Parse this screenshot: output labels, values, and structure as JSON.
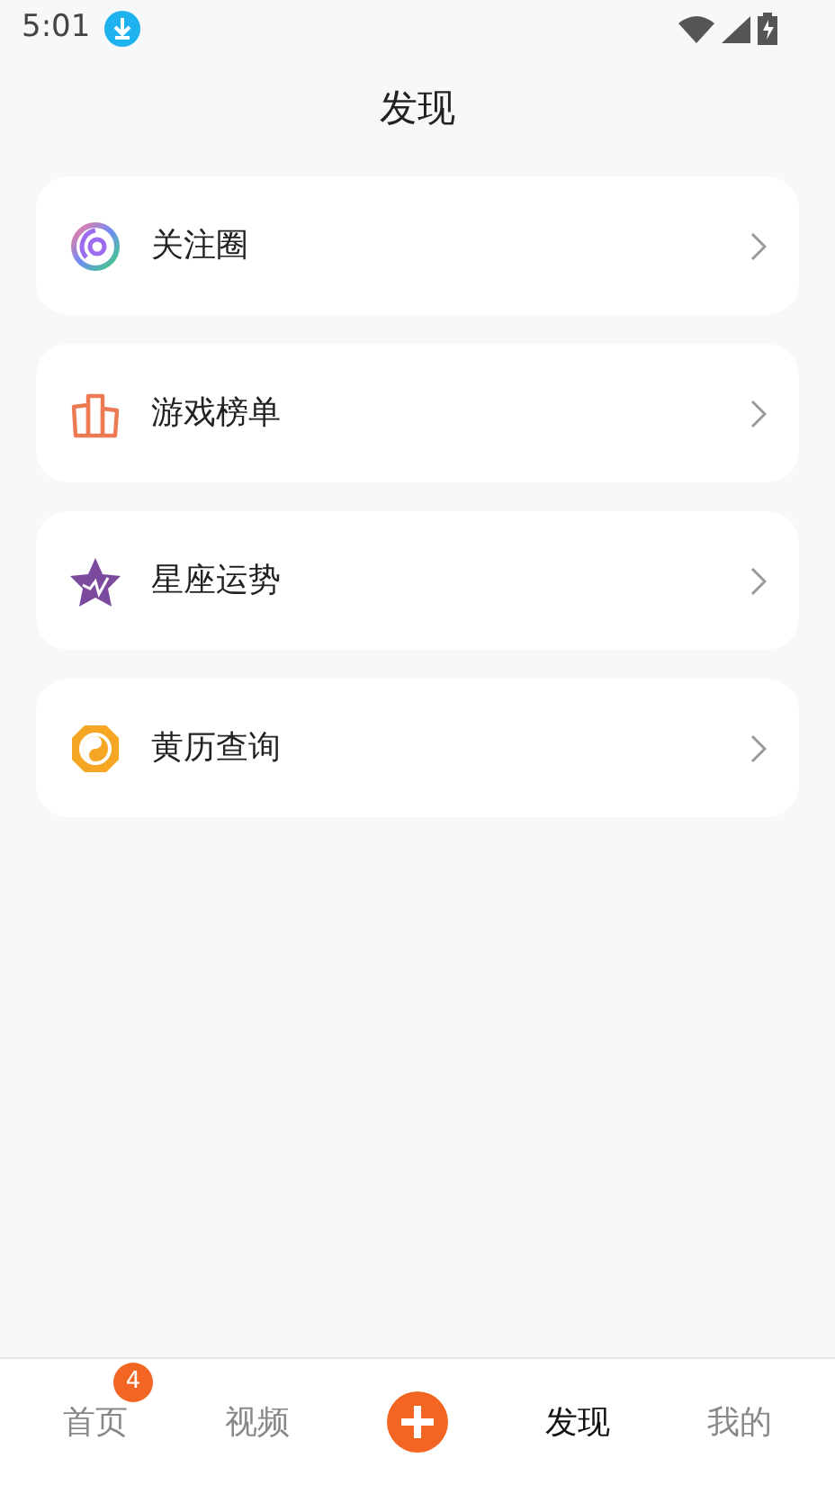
{
  "status_bar": {
    "time": "5:01"
  },
  "header": {
    "title": "发现"
  },
  "menu": [
    {
      "label": "关注圈"
    },
    {
      "label": "游戏榜单"
    },
    {
      "label": "星座运势"
    },
    {
      "label": "黄历查询"
    }
  ],
  "tab_bar": [
    {
      "kind": "tab",
      "label": "首页",
      "badge": "4",
      "selected": false
    },
    {
      "kind": "tab",
      "label": "视频",
      "selected": false
    },
    {
      "kind": "add"
    },
    {
      "kind": "tab",
      "label": "发现",
      "selected": true
    },
    {
      "kind": "tab",
      "label": "我的",
      "selected": false
    }
  ]
}
